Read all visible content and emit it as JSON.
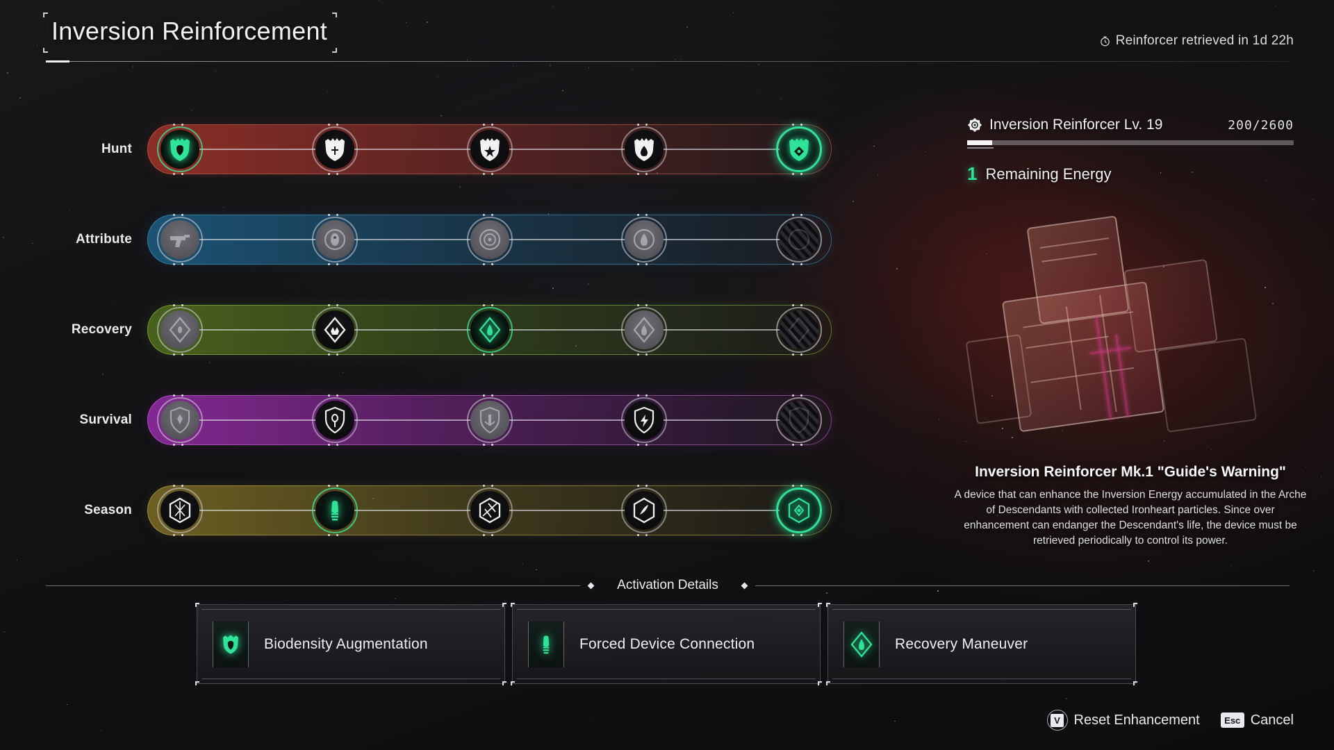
{
  "header": {
    "title": "Inversion Reinforcement",
    "timer_icon": "stopwatch-icon",
    "timer_text": "Reinforcer retrieved in 1d 22h"
  },
  "panel": {
    "badge_icon": "reinforcer-badge-icon",
    "level_text": "Inversion Reinforcer Lv. 19",
    "xp_text": "200/2600",
    "xp_current": 200,
    "xp_max": 2600,
    "energy_count": "1",
    "energy_label": "Remaining Energy",
    "item_name": "Inversion Reinforcer Mk.1 \"Guide's Warning\"",
    "item_desc": "A device that can enhance the Inversion Energy accumulated in the Arche of Descendants with collected Ironheart particles. Since over enhancement can endanger the Descendant's life, the device must be retrieved periodically to control its power."
  },
  "colors": {
    "accent_green": "#2fe39a",
    "hunt": "#963028",
    "attribute": "#1c587c",
    "recovery": "#4e681e",
    "survival": "#8c2a9c",
    "season": "#766824"
  },
  "tracks": [
    {
      "label": "Hunt",
      "theme": "t-hunt",
      "nodes": [
        {
          "icon": "hunt-crest-active-icon",
          "state": "state-active"
        },
        {
          "icon": "hunt-crest-cross-icon",
          "state": "state-idle"
        },
        {
          "icon": "hunt-crest-star-icon",
          "state": "state-idle"
        },
        {
          "icon": "hunt-crest-drop-icon",
          "state": "state-idle"
        },
        {
          "icon": "hunt-crest-final-icon",
          "state": "state-final"
        }
      ]
    },
    {
      "label": "Attribute",
      "theme": "t-attr",
      "nodes": [
        {
          "icon": "attribute-pistol-icon",
          "state": "state-dim"
        },
        {
          "icon": "attribute-orb-icon",
          "state": "state-dim"
        },
        {
          "icon": "attribute-ring-icon",
          "state": "state-dim"
        },
        {
          "icon": "attribute-flame-icon",
          "state": "state-dim"
        },
        {
          "icon": "attribute-locked-icon",
          "state": "state-locked"
        }
      ]
    },
    {
      "label": "Recovery",
      "theme": "t-recov",
      "nodes": [
        {
          "icon": "recovery-diamond-icon",
          "state": "state-dim"
        },
        {
          "icon": "recovery-diamond-crown-icon",
          "state": "state-idle"
        },
        {
          "icon": "recovery-maneuver-icon",
          "state": "state-active"
        },
        {
          "icon": "recovery-diamond-flame-icon",
          "state": "state-dim"
        },
        {
          "icon": "recovery-locked-icon",
          "state": "state-locked"
        }
      ]
    },
    {
      "label": "Survival",
      "theme": "t-surv",
      "nodes": [
        {
          "icon": "survival-shield-icon",
          "state": "state-dim"
        },
        {
          "icon": "survival-shield-eye-icon",
          "state": "state-idle"
        },
        {
          "icon": "survival-shield-anchor-icon",
          "state": "state-dim"
        },
        {
          "icon": "survival-shield-spark-icon",
          "state": "state-idle"
        },
        {
          "icon": "survival-locked-icon",
          "state": "state-locked"
        }
      ]
    },
    {
      "label": "Season",
      "theme": "t-season",
      "nodes": [
        {
          "icon": "season-hex-shard-icon",
          "state": "state-idle"
        },
        {
          "icon": "season-device-icon",
          "state": "state-active"
        },
        {
          "icon": "season-burst-icon",
          "state": "state-idle"
        },
        {
          "icon": "season-wave-icon",
          "state": "state-idle"
        },
        {
          "icon": "season-core-final-icon",
          "state": "state-final"
        }
      ]
    }
  ],
  "divider": {
    "label": "Activation Details"
  },
  "activation_cards": [
    {
      "icon": "biodensity-icon",
      "label": "Biodensity Augmentation"
    },
    {
      "icon": "forced-device-icon",
      "label": "Forced Device Connection"
    },
    {
      "icon": "recovery-maneuver-icon",
      "label": "Recovery Maneuver"
    }
  ],
  "footer": [
    {
      "key": "V",
      "key_style": "circle",
      "label": "Reset Enhancement"
    },
    {
      "key": "Esc",
      "key_style": "box",
      "label": "Cancel"
    }
  ]
}
